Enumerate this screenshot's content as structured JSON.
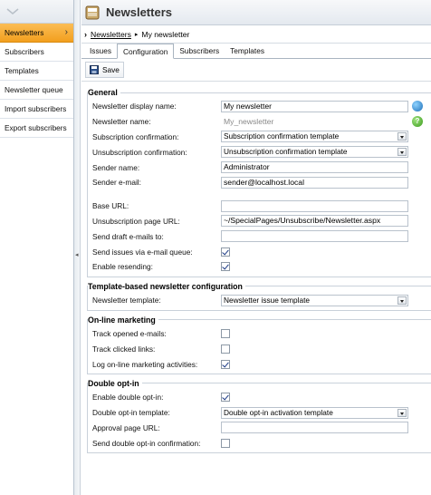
{
  "sidebar": {
    "items": [
      {
        "label": "Newsletters",
        "active": true
      },
      {
        "label": "Subscribers"
      },
      {
        "label": "Templates"
      },
      {
        "label": "Newsletter queue"
      },
      {
        "label": "Import subscribers"
      },
      {
        "label": "Export subscribers"
      }
    ]
  },
  "header": {
    "title": "Newsletters"
  },
  "breadcrumb": {
    "parent": "Newsletters",
    "current": "My newsletter"
  },
  "tabs": [
    "Issues",
    "Configuration",
    "Subscribers",
    "Templates"
  ],
  "toolbar": {
    "save_label": "Save"
  },
  "general": {
    "legend": "General",
    "display_name_label": "Newsletter display name:",
    "display_name_value": "My newsletter",
    "name_label": "Newsletter name:",
    "name_value": "My_newsletter",
    "sub_conf_label": "Subscription confirmation:",
    "sub_conf_value": "Subscription confirmation template",
    "unsub_conf_label": "Unsubscription confirmation:",
    "unsub_conf_value": "Unsubscription confirmation template",
    "sender_name_label": "Sender name:",
    "sender_name_value": "Administrator",
    "sender_email_label": "Sender e-mail:",
    "sender_email_value": "sender@localhost.local",
    "base_url_label": "Base URL:",
    "base_url_value": "",
    "unsub_url_label": "Unsubscription page URL:",
    "unsub_url_value": "~/SpecialPages/Unsubscribe/Newsletter.aspx",
    "draft_label": "Send draft e-mails to:",
    "draft_value": "",
    "queue_label": "Send issues via e-mail queue:",
    "queue_checked": true,
    "resend_label": "Enable resending:",
    "resend_checked": true
  },
  "template_based": {
    "legend": "Template-based newsletter configuration",
    "template_label": "Newsletter template:",
    "template_value": "Newsletter issue template"
  },
  "online_marketing": {
    "legend": "On-line marketing",
    "track_opened_label": "Track opened e-mails:",
    "track_opened_checked": false,
    "track_clicked_label": "Track clicked links:",
    "track_clicked_checked": false,
    "log_label": "Log on-line marketing activities:",
    "log_checked": true
  },
  "double_optin": {
    "legend": "Double opt-in",
    "enable_label": "Enable double opt-in:",
    "enable_checked": true,
    "template_label": "Double opt-in template:",
    "template_value": "Double opt-in activation template",
    "approval_label": "Approval page URL:",
    "approval_value": "",
    "send_conf_label": "Send double opt-in confirmation:",
    "send_conf_checked": false
  },
  "colors": {
    "active_tab_orange": "#f5a623",
    "border": "#c9d1da"
  },
  "icons": [
    "chevron-down-icon",
    "chevron-right-icon",
    "newsletter-icon",
    "save-disk-icon",
    "globe-icon",
    "help-icon"
  ]
}
